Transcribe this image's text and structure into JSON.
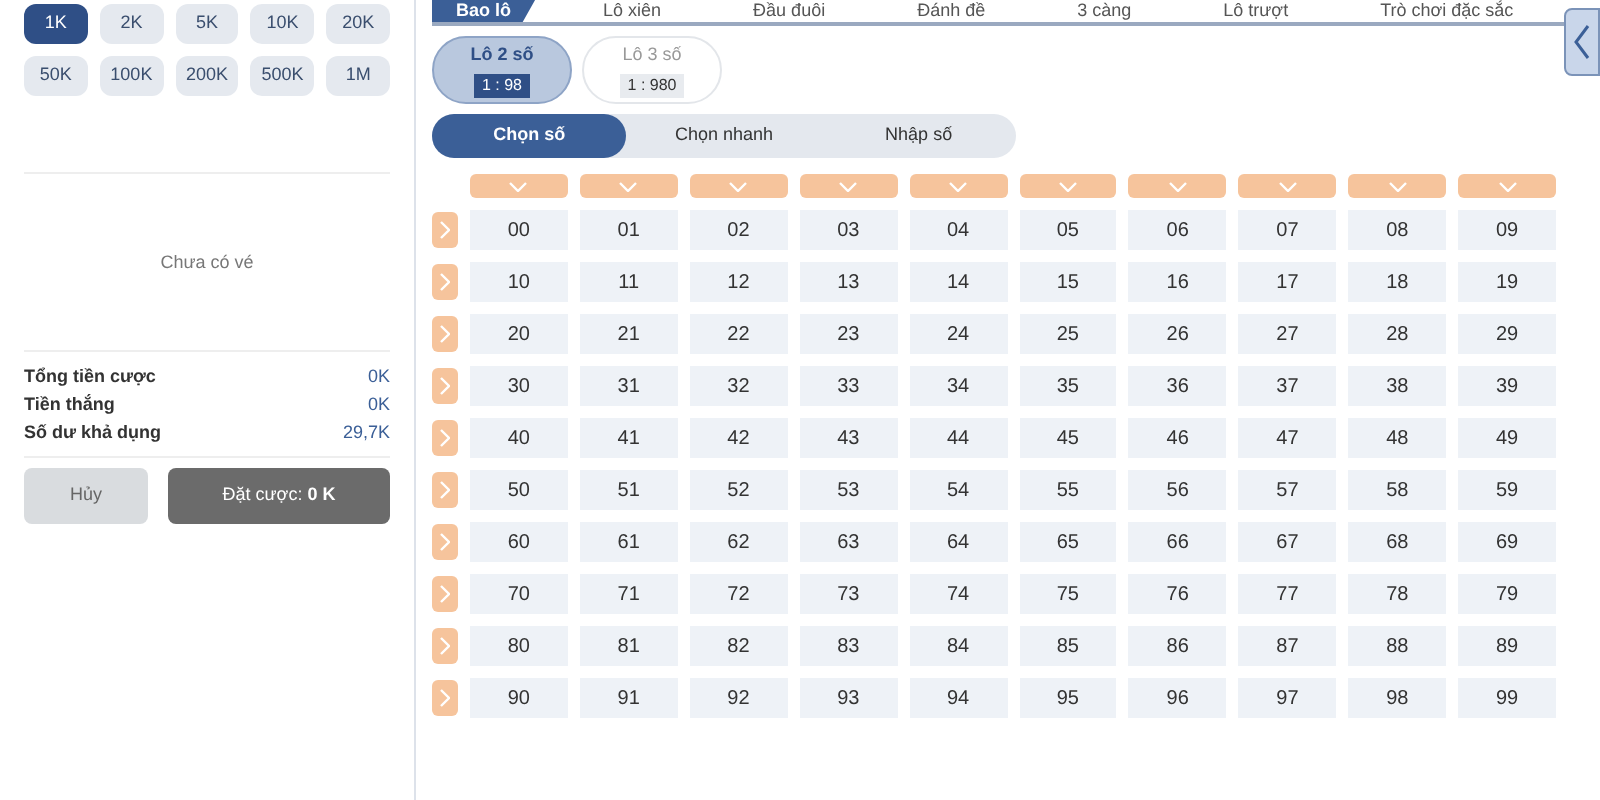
{
  "amount_chips": [
    {
      "label": "1K",
      "selected": true
    },
    {
      "label": "2K",
      "selected": false
    },
    {
      "label": "5K",
      "selected": false
    },
    {
      "label": "10K",
      "selected": false
    },
    {
      "label": "20K",
      "selected": false
    },
    {
      "label": "50K",
      "selected": false
    },
    {
      "label": "100K",
      "selected": false
    },
    {
      "label": "200K",
      "selected": false
    },
    {
      "label": "500K",
      "selected": false
    },
    {
      "label": "1M",
      "selected": false
    }
  ],
  "ticket_status": "Chưa có vé",
  "summary": [
    {
      "label": "Tổng tiền cược",
      "value": "0K"
    },
    {
      "label": "Tiền thắng",
      "value": "0K"
    },
    {
      "label": "Số dư khả dụng",
      "value": "29,7K"
    }
  ],
  "buttons": {
    "cancel": "Hủy",
    "place_bet": "Đặt cược: **0 K**"
  },
  "tabs": [
    {
      "label": "Bao lô",
      "selected": true
    },
    {
      "label": "Lô xiên",
      "selected": false
    },
    {
      "label": "Đầu đuôi",
      "selected": false
    },
    {
      "label": "Đánh đề",
      "selected": false
    },
    {
      "label": "3 càng",
      "selected": false
    },
    {
      "label": "Lô trượt",
      "selected": false
    },
    {
      "label": "Trò chơi đặc sắc",
      "selected": false
    }
  ],
  "bet_types": [
    {
      "label": "Lô 2 số",
      "odds": "1 : 98",
      "selected": true
    },
    {
      "label": "Lô 3 số",
      "odds": "1 : 980",
      "selected": false
    }
  ],
  "modes": [
    {
      "label": "Chọn số",
      "selected": true
    },
    {
      "label": "Chọn nhanh",
      "selected": false
    },
    {
      "label": "Nhập số",
      "selected": false
    }
  ],
  "numbers": [
    [
      "00",
      "01",
      "02",
      "03",
      "04",
      "05",
      "06",
      "07",
      "08",
      "09"
    ],
    [
      "10",
      "11",
      "12",
      "13",
      "14",
      "15",
      "16",
      "17",
      "18",
      "19"
    ],
    [
      "20",
      "21",
      "22",
      "23",
      "24",
      "25",
      "26",
      "27",
      "28",
      "29"
    ],
    [
      "30",
      "31",
      "32",
      "33",
      "34",
      "35",
      "36",
      "37",
      "38",
      "39"
    ],
    [
      "40",
      "41",
      "42",
      "43",
      "44",
      "45",
      "46",
      "47",
      "48",
      "49"
    ],
    [
      "50",
      "51",
      "52",
      "53",
      "54",
      "55",
      "56",
      "57",
      "58",
      "59"
    ],
    [
      "60",
      "61",
      "62",
      "63",
      "64",
      "65",
      "66",
      "67",
      "68",
      "69"
    ],
    [
      "70",
      "71",
      "72",
      "73",
      "74",
      "75",
      "76",
      "77",
      "78",
      "79"
    ],
    [
      "80",
      "81",
      "82",
      "83",
      "84",
      "85",
      "86",
      "87",
      "88",
      "89"
    ],
    [
      "90",
      "91",
      "92",
      "93",
      "94",
      "95",
      "96",
      "97",
      "98",
      "99"
    ]
  ]
}
